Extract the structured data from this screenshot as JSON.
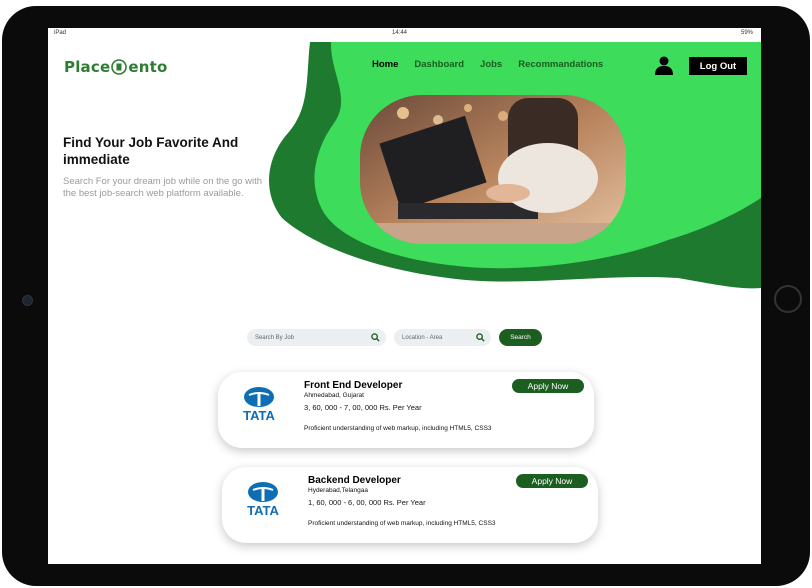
{
  "statusbar": {
    "left": "iPad",
    "time": "14:44",
    "right": "59%"
  },
  "brand": {
    "prefix": "Place",
    "suffix": "ento"
  },
  "nav": {
    "home": "Home",
    "dashboard": "Dashboard",
    "jobs": "Jobs",
    "recommendations": "Recommandations",
    "logout": "Log Out"
  },
  "hero": {
    "title": "Find Your Job Favorite And immediate",
    "subtitle": "Search For your dream job while on the go with the best job-search web platform available."
  },
  "search": {
    "job_placeholder": "Search By Job",
    "location_placeholder": "Location - Area",
    "button": "Search"
  },
  "jobs": [
    {
      "company": "TATA",
      "title": "Front End Developer",
      "location": "Ahmedabad, Gujarat",
      "salary": "3, 60, 000 - 7, 00, 000 Rs. Per Year",
      "description": "Proficient understanding of web markup, including HTML5, CSS3",
      "apply": "Apply Now"
    },
    {
      "company": "TATA",
      "title": "Backend Developer",
      "location": "Hyderabad,Telangaa",
      "salary": "1, 60, 000 - 6, 00, 000 Rs. Per Year",
      "description": "Proficient understanding of web markup, including HTML5, CSS3",
      "apply": "Apply Now"
    }
  ],
  "colors": {
    "brand_green": "#1b5e20",
    "hero_green": "#3ddc5a",
    "dark_green": "#1e7a2f",
    "tata_blue": "#0d6eb5"
  },
  "icons": [
    "user-icon",
    "search-icon",
    "tata-logo"
  ]
}
